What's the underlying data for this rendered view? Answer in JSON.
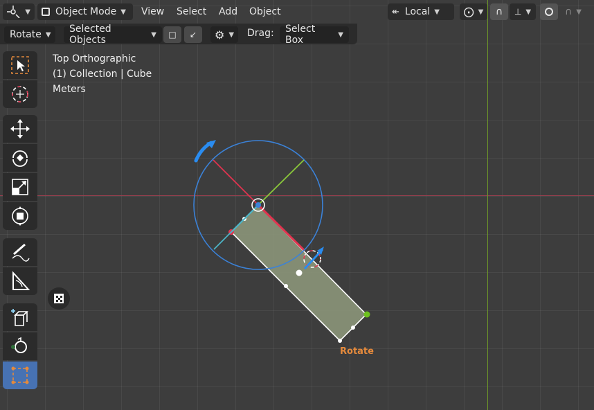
{
  "header": {
    "mode": "Object Mode",
    "menus": [
      "View",
      "Select",
      "Add",
      "Object"
    ],
    "orientation": "Local"
  },
  "toolbar": {
    "transform_tool": "Rotate",
    "pivot": "Selected Objects",
    "drag_label": "Drag:",
    "drag_value": "Select Box"
  },
  "viewport": {
    "view_name": "Top Orthographic",
    "collection": "(1) Collection | Cube",
    "units": "Meters",
    "operation_label": "Rotate"
  },
  "colors": {
    "x_axis": "#e0344f",
    "y_axis": "#8bc93a",
    "z_ring": "#3b82d8",
    "active_tool": "#4772b3",
    "cube_fill": "#8f9a7c",
    "operation_label": "#e58a3c"
  },
  "tools": [
    "select-box-icon",
    "cursor-icon",
    "move-icon",
    "rotate-icon",
    "scale-icon",
    "transform-icon",
    "annotate-icon",
    "measure-icon",
    "add-cube-icon",
    "cylinder-icon",
    "selected-tool-icon"
  ]
}
